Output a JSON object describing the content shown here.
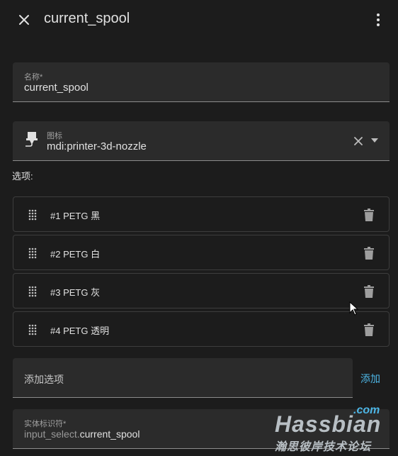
{
  "header": {
    "title": "current_spool"
  },
  "name_field": {
    "label": "名称*",
    "value": "current_spool"
  },
  "icon_field": {
    "label": "图标",
    "value": "mdi:printer-3d-nozzle"
  },
  "options": {
    "label": "选项:",
    "items": [
      {
        "label": "#1 PETG 黑"
      },
      {
        "label": "#2 PETG 白"
      },
      {
        "label": "#3 PETG 灰"
      },
      {
        "label": "#4 PETG 透明"
      }
    ]
  },
  "add_option": {
    "placeholder": "添加选项",
    "button_label": "添加"
  },
  "entity_field": {
    "label": "实体标识符*",
    "prefix": "input_select.",
    "value": "current_spool"
  },
  "watermark": {
    "com": ".com",
    "main": "Hassbian",
    "sub": "瀚思彼岸技术论坛"
  },
  "colors": {
    "background": "#1c1c1c",
    "field": "#2b2b2b",
    "accent": "#4db6e6",
    "text": "#e1e1e1"
  }
}
